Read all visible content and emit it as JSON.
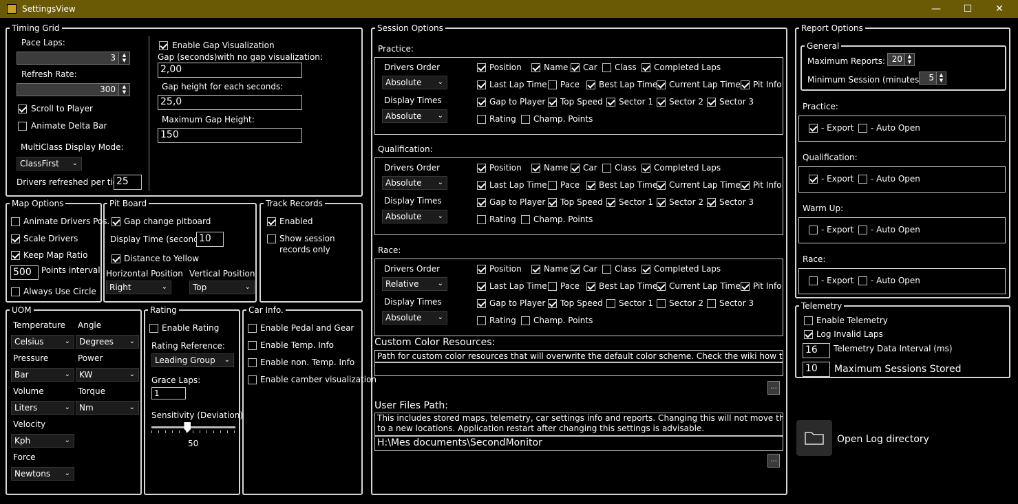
{
  "window": {
    "title": "SettingsView",
    "minimize": "—",
    "maximize": "☐",
    "close": "✕"
  },
  "timing_grid": {
    "title": "Timing Grid",
    "pace_laps_label": "Pace Laps:",
    "pace_laps_value": "3",
    "refresh_rate_label": "Refresh Rate:",
    "refresh_rate_value": "300",
    "scroll_to_player": "Scroll to Player",
    "animate_delta_bar": "Animate Delta Bar",
    "multiclass_label": "MultiClass Display Mode:",
    "multiclass_value": "ClassFirst",
    "drivers_refreshed_label": "Drivers refreshed per tick:",
    "drivers_refreshed_value": "25",
    "enable_gap_visualization": "Enable Gap Visualization",
    "gap_no_vis_label": "Gap (seconds)with no gap visualization:",
    "gap_no_vis_value": "2,00",
    "gap_height_label": "Gap height for each seconds:",
    "gap_height_value": "25,0",
    "max_gap_label": "Maximum Gap Height:",
    "max_gap_value": "150"
  },
  "map_options": {
    "title": "Map Options",
    "animate_drivers": "Animate Drivers Pos.",
    "scale_drivers": "Scale Drivers",
    "keep_map_ratio": "Keep Map Ratio",
    "points_interval_value": "500",
    "points_interval_label": "Points interval",
    "always_use_circle": "Always Use Circle"
  },
  "pit_board": {
    "title": "Pit Board",
    "gap_change": "Gap change pitboard",
    "display_time_label": "Display Time (seconds)",
    "display_time_value": "10",
    "distance_to_yellow": "Distance to Yellow",
    "horizontal_label": "Horizontal Position",
    "horizontal_value": "Right",
    "vertical_label": "Vertical Position",
    "vertical_value": "Top"
  },
  "track_records": {
    "title": "Track Records",
    "enabled": "Enabled",
    "show_session_1": "Show session",
    "show_session_2": "records only"
  },
  "uom": {
    "title": "UOM",
    "temperature_label": "Temperature",
    "temperature_value": "Celsius",
    "angle_label": "Angle",
    "angle_value": "Degrees",
    "pressure_label": "Pressure",
    "pressure_value": "Bar",
    "power_label": "Power",
    "power_value": "KW",
    "volume_label": "Volume",
    "volume_value": "Liters",
    "torque_label": "Torque",
    "torque_value": "Nm",
    "velocity_label": "Velocity",
    "velocity_value": "Kph",
    "force_label": "Force",
    "force_value": "Newtons"
  },
  "rating": {
    "title": "Rating",
    "enable_rating": "Enable Rating",
    "reference_label": "Rating Reference:",
    "reference_value": "Leading Group",
    "grace_laps_label": "Grace Laps:",
    "grace_laps_value": "1",
    "sensitivity_label": "Sensitivity (Deviation)",
    "sensitivity_value": "50",
    "sensitivity_fraction": 0.43
  },
  "car_info": {
    "title": "Car Info.",
    "pedal_gear": "Enable Pedal and Gear",
    "temp_info": "Enable Temp. Info",
    "non_temp_info": "Enable non. Temp. Info",
    "camber": "Enable camber visualization"
  },
  "session_options": {
    "title": "Session Options",
    "drivers_order_label": "Drivers Order",
    "display_times_label": "Display Times",
    "columns": {
      "position": "Position",
      "name": "Name",
      "car": "Car",
      "class": "Class",
      "completed_laps": "Completed Laps",
      "last_lap_time": "Last Lap Time",
      "pace": "Pace",
      "best_lap_time": "Best Lap Time",
      "current_lap_time": "Current Lap Time",
      "pit_info": "Pit Info",
      "gap_to_player": "Gap to Player",
      "top_speed": "Top Speed",
      "sector1": "Sector 1",
      "sector2": "Sector 2",
      "sector3": "Sector 3",
      "rating": "Rating",
      "champ_points": "Champ. Points"
    },
    "sessions": [
      {
        "label": "Practice:",
        "order": "Absolute",
        "times": "Absolute",
        "checks": [
          true,
          true,
          true,
          false,
          true,
          true,
          false,
          true,
          true,
          true,
          true,
          true,
          true,
          true,
          true,
          false,
          false
        ]
      },
      {
        "label": "Qualification:",
        "order": "Absolute",
        "times": "Absolute",
        "checks": [
          true,
          true,
          true,
          false,
          true,
          true,
          false,
          true,
          true,
          true,
          true,
          true,
          true,
          true,
          true,
          false,
          false
        ]
      },
      {
        "label": "Race:",
        "order": "Relative",
        "times": "Absolute",
        "checks": [
          true,
          true,
          true,
          false,
          true,
          true,
          false,
          true,
          true,
          true,
          true,
          true,
          false,
          false,
          false,
          false,
          false
        ]
      }
    ],
    "custom_color_title": "Custom Color Resources:",
    "custom_color_desc": "Path for custom color resources that will overwrite the default color scheme. Check the wiki how to write them.",
    "custom_color_value": "",
    "user_files_title": "User Files Path:",
    "user_files_desc_1": "This includes stored maps, telemetry, car settings info and reports. Changing this will not move the existing files",
    "user_files_desc_2": "to a new locations. Application restart after changing this settings is advisable.",
    "user_files_value": "H:\\Mes documents\\SecondMonitor",
    "browse_label": "..."
  },
  "report_options": {
    "title": "Report Options",
    "general_title": "General",
    "max_reports_label": "Maximum Reports:",
    "max_reports_value": "20",
    "min_session_label": "Minimum Session (minutes):",
    "min_session_value": "5",
    "export_label": "- Export",
    "auto_open_label": "- Auto Open",
    "sessions": [
      {
        "label": "Practice:",
        "export": true,
        "auto_open": false
      },
      {
        "label": "Qualification:",
        "export": true,
        "auto_open": false
      },
      {
        "label": "Warm Up:",
        "export": false,
        "auto_open": false
      },
      {
        "label": "Race:",
        "export": false,
        "auto_open": false
      }
    ]
  },
  "telemetry": {
    "title": "Telemetry",
    "enable": "Enable Telemetry",
    "log_invalid": "Log Invalid Laps",
    "interval_value": "16",
    "interval_label": "Telemetry Data Interval (ms)",
    "max_sessions_value": "10",
    "max_sessions_label": "Maximum Sessions Stored"
  },
  "open_log": {
    "label": "Open Log directory"
  }
}
